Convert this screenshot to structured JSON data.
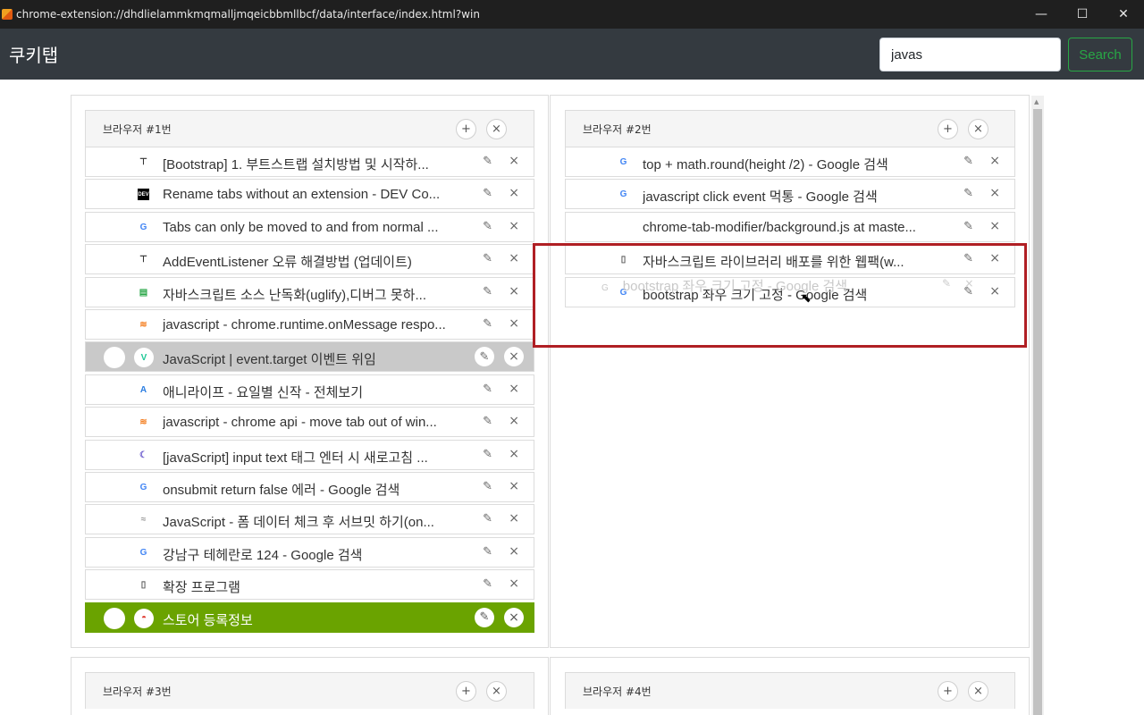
{
  "window": {
    "title": "chrome-extension://dhdlielammkmqmalljmqeicbbmllbcf/data/interface/index.html?win",
    "controls": [
      "—",
      "☐",
      "✕"
    ]
  },
  "header": {
    "brand": "쿠키탭",
    "search_value": "javas",
    "search_button": "Search"
  },
  "panels": [
    {
      "title": "브라우저 #1번",
      "tabs": [
        {
          "favicon": "bootstrap-tree-icon",
          "label": "[Bootstrap] 1. 부트스트랩 설치방법 및 시작하..."
        },
        {
          "favicon": "dev-icon",
          "label": "Rename tabs without an extension - DEV Co..."
        },
        {
          "favicon": "google-icon",
          "label": "Tabs can only be moved to and from normal ..."
        },
        {
          "favicon": "bootstrap-tree-icon",
          "label": "AddEventListener 오류 해결방법 (업데이트)"
        },
        {
          "favicon": "green-doc-icon",
          "label": "자바스크립트 소스 난독화(uglify),디버그 못하..."
        },
        {
          "favicon": "stackoverflow-icon",
          "label": "javascript - chrome.runtime.onMessage respo..."
        },
        {
          "favicon": "velog-icon",
          "label": "JavaScript | event.target 이벤트 위임",
          "state": "active"
        },
        {
          "favicon": "ani-icon",
          "label": "애니라이프 - 요일별 신작 - 전체보기"
        },
        {
          "favicon": "stackoverflow-icon",
          "label": "javascript - chrome api - move tab out of win..."
        },
        {
          "favicon": "moon-icon",
          "label": "[javaScript] input text 태그 엔터 시 새로고침 ..."
        },
        {
          "favicon": "google-icon",
          "label": "onsubmit return false 에러 - Google 검색"
        },
        {
          "favicon": "tistory-icon",
          "label": "JavaScript - 폼 데이터 체크 후 서브밋 하기(on..."
        },
        {
          "favicon": "google-icon",
          "label": "강남구 테헤란로 124 - Google 검색"
        },
        {
          "favicon": "document-icon",
          "label": "확장 프로그램"
        },
        {
          "favicon": "webstore-icon",
          "label": "스토어 등록정보",
          "state": "green"
        }
      ]
    },
    {
      "title": "브라우저 #2번",
      "tabs": [
        {
          "favicon": "google-icon",
          "label": "top + math.round(height /2) - Google 검색"
        },
        {
          "favicon": "google-icon",
          "label": "javascript click event 먹통 - Google 검색"
        },
        {
          "favicon": "",
          "label": "chrome-tab-modifier/background.js at maste..."
        },
        {
          "favicon": "document-icon",
          "label": "자바스크립트 라이브러리 배포를 위한 웹팩(w..."
        },
        {
          "favicon": "google-icon",
          "label": "bootstrap 좌우 크기 고정 - Google 검색"
        }
      ],
      "drag_ghost": "bootstrap 좌우 크기 고정 - Google 검색"
    },
    {
      "title": "브라우저 #3번",
      "tabs": []
    },
    {
      "title": "브라우저 #4번",
      "tabs": []
    }
  ],
  "icons": {
    "add": "+",
    "close": "×",
    "edit": "✎"
  },
  "colors": {
    "header_bg": "#343a40",
    "search_green": "#28a745",
    "active_row": "#c9c9c9",
    "green_row": "#6aa300",
    "highlight_red": "#b01f24"
  }
}
